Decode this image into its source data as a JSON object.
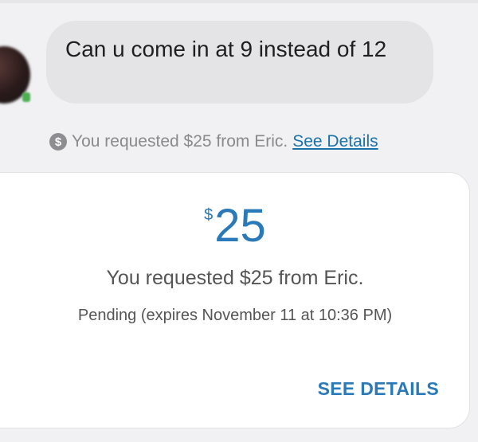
{
  "message": {
    "text": "Can u come in at 9 instead of 12"
  },
  "notice": {
    "icon": "dollar-circle-icon",
    "text": "You requested $25 from Eric.",
    "link_label": "See Details"
  },
  "payment_card": {
    "currency_symbol": "$",
    "amount": "25",
    "description": "You requested $25 from Eric.",
    "status": "Pending (expires November 11 at 10:36 PM)",
    "action_label": "SEE DETAILS"
  },
  "colors": {
    "accent": "#2a79b8",
    "link": "#1a73a8",
    "bubble": "#e4e4e6",
    "background": "#f1f1f3"
  }
}
